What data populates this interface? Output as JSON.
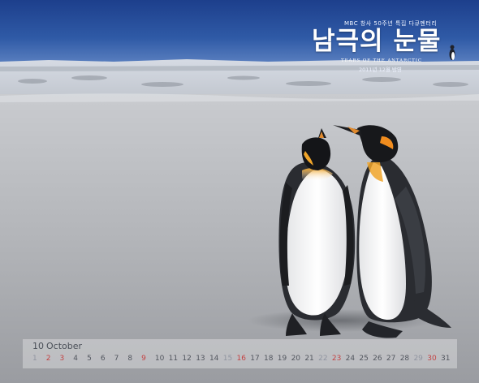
{
  "poster": {
    "broadcaster": "MBC 창사 50주년 특집 다큐멘터리",
    "title": "남극의 눈물",
    "subtitle": "TEARS OF THE ANTARCTIC",
    "air_date": "2011년 12월 방영"
  },
  "calendar": {
    "month_number": "10",
    "month_name": "October",
    "days": [
      {
        "d": "1",
        "c": "light"
      },
      {
        "d": "2",
        "c": "red"
      },
      {
        "d": "3",
        "c": "red"
      },
      {
        "d": "4",
        "c": ""
      },
      {
        "d": "5",
        "c": ""
      },
      {
        "d": "6",
        "c": ""
      },
      {
        "d": "7",
        "c": ""
      },
      {
        "d": "8",
        "c": ""
      },
      {
        "d": "9",
        "c": "red"
      },
      {
        "d": "10",
        "c": ""
      },
      {
        "d": "11",
        "c": ""
      },
      {
        "d": "12",
        "c": ""
      },
      {
        "d": "13",
        "c": ""
      },
      {
        "d": "14",
        "c": ""
      },
      {
        "d": "15",
        "c": "light"
      },
      {
        "d": "16",
        "c": "red"
      },
      {
        "d": "17",
        "c": ""
      },
      {
        "d": "18",
        "c": ""
      },
      {
        "d": "19",
        "c": ""
      },
      {
        "d": "20",
        "c": ""
      },
      {
        "d": "21",
        "c": ""
      },
      {
        "d": "22",
        "c": "light"
      },
      {
        "d": "23",
        "c": "red"
      },
      {
        "d": "24",
        "c": ""
      },
      {
        "d": "25",
        "c": ""
      },
      {
        "d": "26",
        "c": ""
      },
      {
        "d": "27",
        "c": ""
      },
      {
        "d": "28",
        "c": ""
      },
      {
        "d": "29",
        "c": "light"
      },
      {
        "d": "30",
        "c": "red"
      },
      {
        "d": "31",
        "c": ""
      }
    ]
  }
}
